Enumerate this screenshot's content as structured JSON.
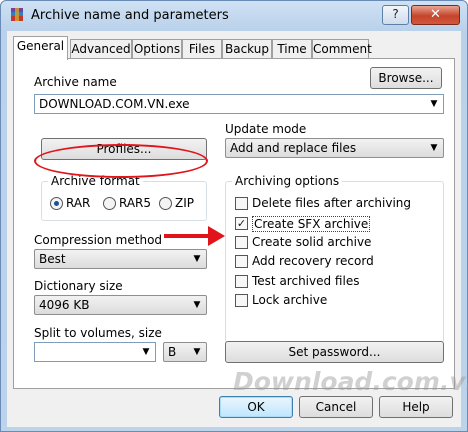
{
  "window": {
    "title": "Archive name and parameters",
    "help_label": "?",
    "close_label": "✕"
  },
  "tabs": [
    {
      "label": "General",
      "active": true
    },
    {
      "label": "Advanced"
    },
    {
      "label": "Options"
    },
    {
      "label": "Files"
    },
    {
      "label": "Backup"
    },
    {
      "label": "Time"
    },
    {
      "label": "Comment"
    }
  ],
  "archive_name": {
    "label": "Archive name",
    "value": "DOWNLOAD.COM.VN.exe",
    "browse_label": "Browse..."
  },
  "profiles_label": "Profiles...",
  "update_mode": {
    "label": "Update mode",
    "value": "Add and replace files"
  },
  "archive_format": {
    "label": "Archive format",
    "options": [
      "RAR",
      "RAR5",
      "ZIP"
    ],
    "selected": "RAR"
  },
  "compression": {
    "label": "Compression method",
    "value": "Best"
  },
  "dictionary": {
    "label": "Dictionary size",
    "value": "4096 KB"
  },
  "split": {
    "label": "Split to volumes, size",
    "value": "",
    "unit": "B"
  },
  "archiving_options": {
    "label": "Archiving options",
    "items": [
      {
        "label": "Delete files after archiving",
        "checked": false
      },
      {
        "label": "Create SFX archive",
        "checked": true
      },
      {
        "label": "Create solid archive",
        "checked": false
      },
      {
        "label": "Add recovery record",
        "checked": false
      },
      {
        "label": "Test archived files",
        "checked": false
      },
      {
        "label": "Lock archive",
        "checked": false
      }
    ]
  },
  "set_password_label": "Set password...",
  "footer": {
    "ok": "OK",
    "cancel": "Cancel",
    "help": "Help"
  },
  "watermark": "Download.com.vn",
  "colors": {
    "annotation": "#e0141a",
    "title_gradient": "#b9d1ea"
  }
}
